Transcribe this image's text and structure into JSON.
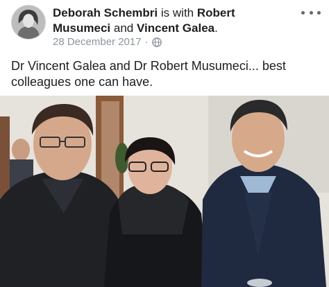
{
  "post": {
    "author": "Deborah Schembri",
    "with_text": "is with",
    "tagged_1": "Robert Musumeci",
    "and_text": "and",
    "tagged_2": "Vincent Galea",
    "period": ".",
    "date": "28 December 2017",
    "separator": "·",
    "privacy_icon": "globe-icon",
    "menu_icon": "more-options-icon",
    "text": "Dr Vincent Galea and Dr Robert Musumeci... best colleagues one can have."
  },
  "colors": {
    "text": "#1c1e21",
    "meta": "#8d949e"
  }
}
